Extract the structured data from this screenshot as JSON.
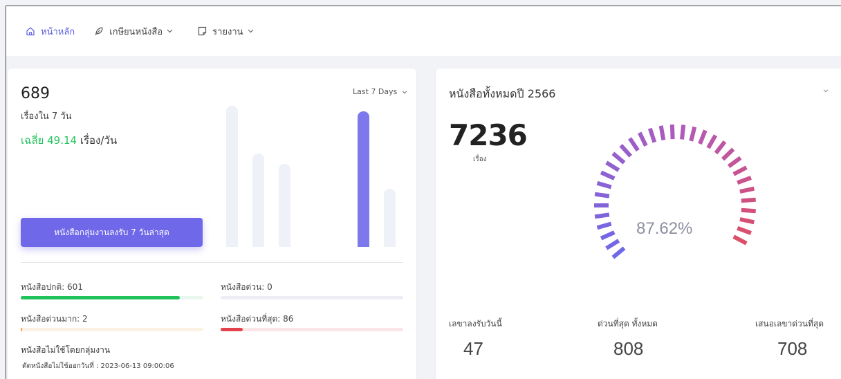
{
  "nav": {
    "home": "หน้าหลัก",
    "retire": "เกษียนหนังสือ",
    "report": "รายงาน"
  },
  "summary": {
    "count": "689",
    "sub_label": "เรื่องใน 7 วัน",
    "avg_prefix": "เฉลี่ย",
    "avg_value": "49.14",
    "avg_suffix": "เรื่อง/วัน",
    "period": "Last 7 Days",
    "button_label": "หนังสือกลุ่มงานลงรับ 7 วันล่าสุด"
  },
  "weekly_bars": {
    "values": [
      100,
      66,
      59,
      0,
      0,
      96,
      41
    ],
    "highlight_index": 5
  },
  "stats": [
    {
      "label": "หนังสือปกติ: 601",
      "fraction": 0.87,
      "fill": "#1fc35a",
      "track": "#e8f8ee"
    },
    {
      "label": "หนังสือด่วน: 0",
      "fraction": 0.0,
      "fill": "#7d79ec",
      "track": "#ededf8"
    },
    {
      "label": "หนังสือด่วนมาก: 2",
      "fraction": 0.004,
      "fill": "#f5a04b",
      "track": "#fdf1e4"
    },
    {
      "label": "หนังสือด่วนที่สุด: 86",
      "fraction": 0.12,
      "fill": "#e4424a",
      "track": "#fbe5e6"
    }
  ],
  "note": {
    "title": "หนังสือไม่ใช้โดยกลุ่มงาน",
    "date_line": "ดัดหนังสือไม่ใช้ออกวันที่ : 2023-06-13 09:00:06"
  },
  "year_panel": {
    "title": "หนังสือทั้งหมดปี 2566",
    "total": "7236",
    "unit": "เรื่อง",
    "percent": "87.62%",
    "percent_value": 0.8762,
    "colors": {
      "start": "#6f68e8",
      "mid": "#b25ab8",
      "end": "#e84a52"
    },
    "footer": [
      {
        "label": "เลขาลงรับวันนี้",
        "value": "47"
      },
      {
        "label": "ด่วนที่สุด ทั้งหมด",
        "value": "808"
      },
      {
        "label": "เสนอเลขาด่วนที่สุด",
        "value": "708"
      }
    ]
  }
}
